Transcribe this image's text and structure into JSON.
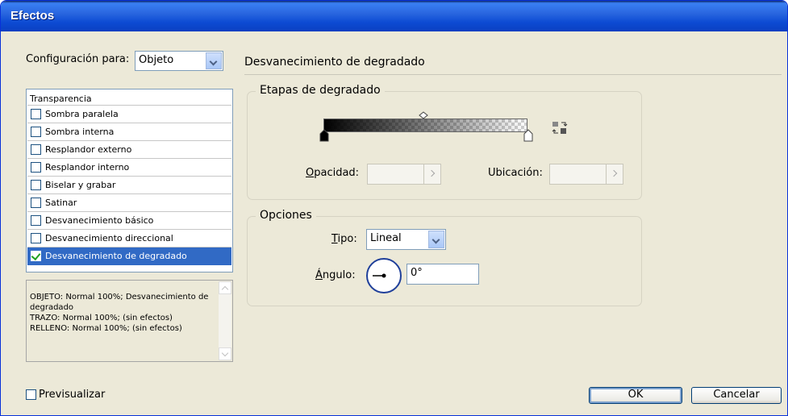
{
  "window": {
    "title": "Efectos"
  },
  "config": {
    "label": "Configuración para:",
    "label_mnemonic": "g",
    "value": "Objeto"
  },
  "section_title": "Desvanecimiento de degradado",
  "list": {
    "header": "Transparencia",
    "items": [
      {
        "label": "Sombra paralela",
        "checked": false
      },
      {
        "label": "Sombra interna",
        "checked": false
      },
      {
        "label": "Resplandor externo",
        "checked": false
      },
      {
        "label": "Resplandor interno",
        "checked": false
      },
      {
        "label": "Biselar y grabar",
        "checked": false
      },
      {
        "label": "Satinar",
        "checked": false
      },
      {
        "label": "Desvanecimiento básico",
        "checked": false
      },
      {
        "label": "Desvanecimiento direccional",
        "checked": false
      },
      {
        "label": "Desvanecimiento de degradado",
        "checked": true
      }
    ]
  },
  "summary": {
    "lines": [
      "OBJETO: Normal 100%; Desvanecimiento de degradado",
      "TRAZO: Normal 100%; (sin efectos)",
      "RELLENO: Normal 100%; (sin efectos)"
    ]
  },
  "gradient_stops": {
    "legend": "Etapas de degradado",
    "opacity_label_first": "O",
    "opacity_label_rest": "pacidad:",
    "location_label": "Ubicación:",
    "opacity_value": "",
    "location_value": ""
  },
  "options": {
    "legend": "Opciones",
    "type_label_first": "T",
    "type_label_rest": "ipo:",
    "type_value": "Lineal",
    "angle_label_first": "Á",
    "angle_label_rest": "ngulo:",
    "angle_value": "0°"
  },
  "preview": {
    "label": "Previsualizar",
    "checked": false
  },
  "buttons": {
    "ok": "OK",
    "cancel": "Cancelar"
  },
  "colors": {
    "title_bar": "#0a3fc2",
    "selection": "#316ac5",
    "face": "#ece9d8"
  }
}
